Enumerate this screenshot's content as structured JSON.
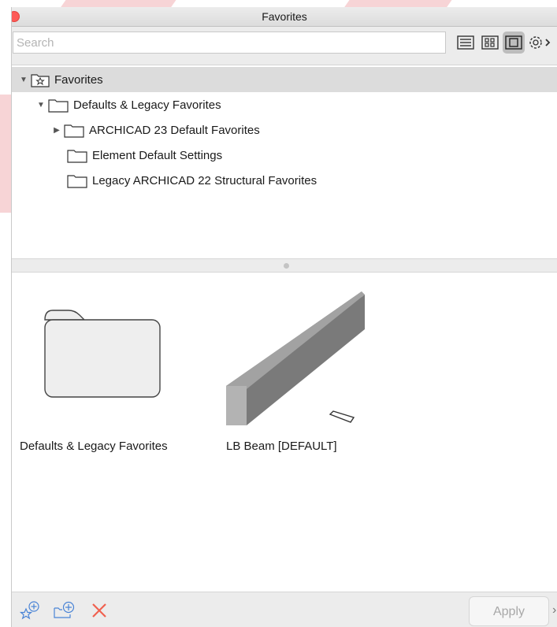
{
  "window": {
    "title": "Favorites"
  },
  "search": {
    "placeholder": "Search"
  },
  "toolbar": {
    "view_buttons": [
      "list-view-icon",
      "grid-view-icon",
      "preview-view-icon",
      "settings-gear-icon"
    ],
    "active_view": "preview-view-icon"
  },
  "tree": {
    "items": [
      {
        "label": "Favorites",
        "icon": "star-folder-icon",
        "expanded": true,
        "selected": true
      },
      {
        "label": "Defaults & Legacy Favorites",
        "icon": "folder-icon",
        "expanded": true
      },
      {
        "label": "ARCHICAD 23 Default Favorites",
        "icon": "folder-icon",
        "expanded": false
      },
      {
        "label": "Element Default Settings",
        "icon": "folder-icon"
      },
      {
        "label": "Legacy ARCHICAD 22 Structural Favorites",
        "icon": "folder-icon"
      }
    ]
  },
  "content": {
    "items": [
      {
        "label": "Defaults & Legacy Favorites",
        "icon": "folder-icon"
      },
      {
        "label": "LB Beam [DEFAULT]",
        "icon": "beam-icon"
      }
    ]
  },
  "footer": {
    "apply_label": "Apply",
    "more_glyph": "›",
    "buttons": [
      "add-favorite-icon",
      "new-folder-icon",
      "delete-icon"
    ]
  },
  "colors": {
    "close": "#fd5a57",
    "delete": "#f0604f",
    "selection": "#dcdcdc"
  }
}
